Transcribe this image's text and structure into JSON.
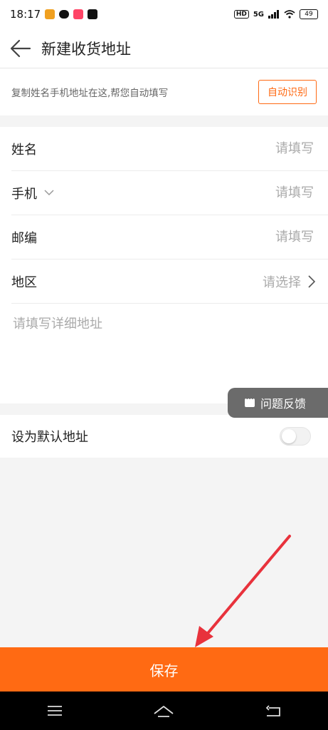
{
  "status_bar": {
    "time": "18:17",
    "hd": "HD",
    "network": "5G",
    "battery": "49"
  },
  "header": {
    "title": "新建收货地址",
    "back_icon": "arrow-left-icon"
  },
  "paste_bar": {
    "hint": "复制姓名手机地址在这,帮您自动填写",
    "button_label": "自动识别"
  },
  "form": {
    "name": {
      "label": "姓名",
      "placeholder": "请填写",
      "value": ""
    },
    "phone": {
      "label": "手机",
      "placeholder": "请填写",
      "value": ""
    },
    "postcode": {
      "label": "邮编",
      "placeholder": "请填写",
      "value": ""
    },
    "region": {
      "label": "地区",
      "placeholder": "请选择"
    },
    "detail": {
      "placeholder": "请填写详细地址",
      "value": ""
    }
  },
  "default_address": {
    "label": "设为默认地址",
    "enabled": false
  },
  "feedback": {
    "label": "问题反馈"
  },
  "save": {
    "label": "保存"
  },
  "colors": {
    "accent": "#ff6a13",
    "annotation": "#e8323c"
  }
}
